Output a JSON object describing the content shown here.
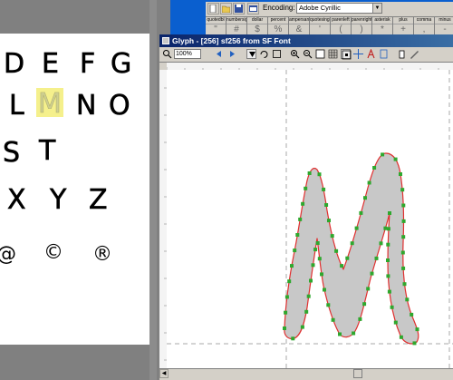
{
  "font_window": {
    "encoding_label": "Encoding:",
    "encoding_value": "Adobe Cyrillic",
    "glyph_columns": [
      {
        "name": "quotedbl",
        "char": "\""
      },
      {
        "name": "numbersign",
        "char": "#"
      },
      {
        "name": "dollar",
        "char": "$"
      },
      {
        "name": "percent",
        "char": "%"
      },
      {
        "name": "ampersand",
        "char": "&"
      },
      {
        "name": "quotesingle",
        "char": "'"
      },
      {
        "name": "parenleft",
        "char": "("
      },
      {
        "name": "parenright",
        "char": ")"
      },
      {
        "name": "asterisk",
        "char": "*"
      },
      {
        "name": "plus",
        "char": "+"
      },
      {
        "name": "comma",
        "char": ","
      },
      {
        "name": "minus",
        "char": "-"
      }
    ]
  },
  "glyph_window": {
    "title": "Glyph - [256] sf256 from SF Font",
    "zoom": "100%"
  },
  "char_map": {
    "rows": [
      [
        "D",
        "E",
        "F",
        "G"
      ],
      [
        "L",
        "M",
        "N",
        "O"
      ],
      [
        "S",
        "T"
      ],
      [
        "X",
        "Y",
        "Z"
      ],
      [
        "@",
        "©",
        "®"
      ]
    ],
    "selected": "M",
    "selected_color": "#f5f08c"
  },
  "colors": {
    "outline": "#e03030",
    "fill": "#c8c8c8",
    "point": "#2ea82e",
    "title_bar": "#0a246a",
    "top_bar": "#0a5fcf"
  }
}
